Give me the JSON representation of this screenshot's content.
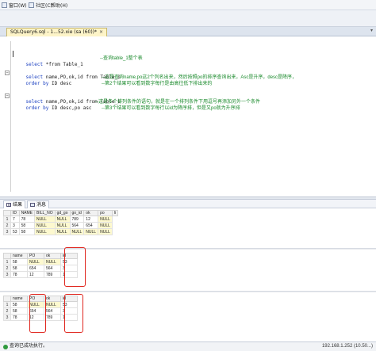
{
  "menu": {
    "items": [
      {
        "label": "窗口(W)"
      },
      {
        "label": "社区(C)"
      },
      {
        "label": "帮助(H)"
      }
    ]
  },
  "tab": {
    "title": "SQLQuery6.sql - 1...52.xie (sa (60))*",
    "close": "×",
    "arrow": "▾"
  },
  "editor": {
    "lines": [
      {
        "kw": "select",
        "rest": " *from Table_1"
      },
      {
        "kw": "select",
        "rest": " name,PO,ok,id from Table_1"
      },
      {
        "kw": "order by",
        "rest": " ID desc"
      },
      {
        "kw": "select",
        "rest": " name,PO,ok,id from Table_1"
      },
      {
        "kw": "order by",
        "rest": " ID desc,po asc"
      }
    ],
    "comments": [
      "--查询table_1整个表",
      "--这是查询name,po这2个列名出来，然后按照po的排序查询出来，Asc是升序，desc是降序，",
      "--第2个结果可以看到数字每行是由高往低下排出来的",
      "--这是多个排列条件的语句，就是在一个排列条件下用逗号再添加另外一个条件",
      "--第3个结果可以看到数字每行以id为降序排，但是又po就为升序排"
    ]
  },
  "results_tabs": {
    "results": "结果",
    "messages": "消息"
  },
  "grids": [
    {
      "columns": [
        "ID",
        "NAME",
        "BILL_NO",
        "gd_go",
        "go_id",
        "ok",
        "po",
        "li"
      ],
      "rows": [
        [
          "1",
          "7",
          "78",
          "NULL",
          "NULL",
          "789",
          "12",
          "NULL"
        ],
        [
          "2",
          "3",
          "58",
          "NULL",
          "NULL",
          "564",
          "654",
          "NULL"
        ],
        [
          "3",
          "53",
          "58",
          "NULL",
          "NULL",
          "NULL",
          "NULL",
          "NULL"
        ]
      ]
    },
    {
      "columns": [
        "name",
        "PO",
        "ok",
        "id"
      ],
      "rows": [
        [
          "1",
          "58",
          "NULL",
          "NULL",
          "53"
        ],
        [
          "2",
          "58",
          "654",
          "564",
          "3"
        ],
        [
          "3",
          "78",
          "12",
          "789",
          "1"
        ]
      ]
    },
    {
      "columns": [
        "name",
        "PO",
        "ok",
        "id"
      ],
      "rows": [
        [
          "1",
          "58",
          "NULL",
          "NULL",
          "53"
        ],
        [
          "2",
          "58",
          "654",
          "564",
          "3"
        ],
        [
          "3",
          "78",
          "12",
          "789",
          "1"
        ]
      ]
    }
  ],
  "status": {
    "message": "查询已成功执行。",
    "ip": "192.168.1.252 (10.50...)"
  },
  "colors": {
    "keyword": "#1a3fc0",
    "comment": "#1a8a2c",
    "null_cell": "#fdf9cf",
    "highlight": "#e0261e",
    "tab_active": "#fdf4c8"
  }
}
